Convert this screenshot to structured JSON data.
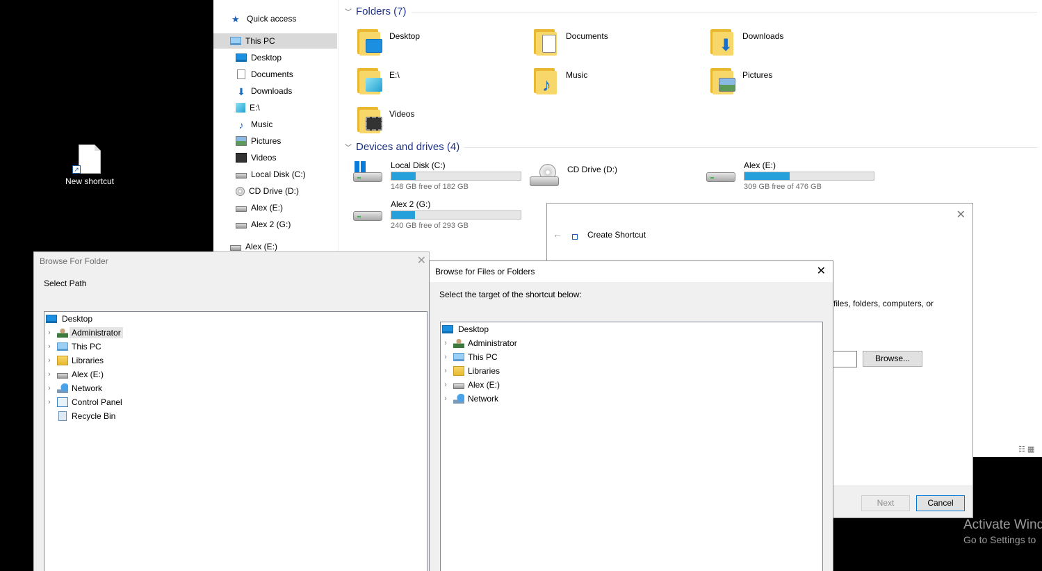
{
  "desktop": {
    "shortcut_label": "New shortcut",
    "watermark_line1": "Activate Wind",
    "watermark_line2": "Go to Settings to"
  },
  "explorer": {
    "nav": {
      "quick_access": "Quick access",
      "this_pc": "This PC",
      "items": [
        "Desktop",
        "Documents",
        "Downloads",
        "E:\\",
        "Music",
        "Pictures",
        "Videos",
        "Local Disk (C:)",
        "CD Drive (D:)",
        "Alex (E:)",
        "Alex 2 (G:)"
      ],
      "bottom_item": "Alex (E:)"
    },
    "folders_header": "Folders (7)",
    "folders": [
      "Desktop",
      "Documents",
      "Downloads",
      "E:\\",
      "Music",
      "Pictures",
      "Videos"
    ],
    "drives_header": "Devices and drives (4)",
    "drives": [
      {
        "name": "Local Disk (C:)",
        "free": "148 GB free of 182 GB",
        "used_fraction": 0.187
      },
      {
        "name": "CD Drive (D:)",
        "free": "",
        "used_fraction": 0
      },
      {
        "name": "Alex (E:)",
        "free": "309 GB free of 476 GB",
        "used_fraction": 0.351
      },
      {
        "name": "Alex 2 (G:)",
        "free": "240 GB free of 293 GB",
        "used_fraction": 0.181
      }
    ],
    "colors": {
      "bar_fill": "#26a0da",
      "header_text": "#1e3287"
    }
  },
  "wizard": {
    "title": "Create Shortcut",
    "description_fragment": "files, folders, computers, or",
    "browse_label": "Browse...",
    "next_label": "Next",
    "cancel_label": "Cancel"
  },
  "browse_folder": {
    "title": "Browse For Folder",
    "prompt": "Select Path",
    "tree": [
      "Desktop",
      "Administrator",
      "This PC",
      "Libraries",
      "Alex (E:)",
      "Network",
      "Control Panel",
      "Recycle Bin"
    ]
  },
  "browse_files": {
    "title": "Browse for Files or Folders",
    "prompt": "Select the target of the shortcut below:",
    "tree": [
      "Desktop",
      "Administrator",
      "This PC",
      "Libraries",
      "Alex (E:)",
      "Network"
    ]
  }
}
